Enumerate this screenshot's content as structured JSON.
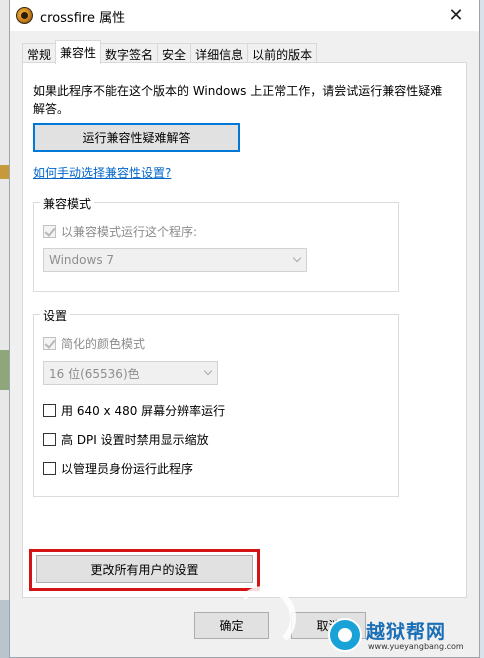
{
  "window": {
    "title": "crossfire 属性",
    "close_label": "✕"
  },
  "tabs": [
    {
      "label": "常规",
      "active": false
    },
    {
      "label": "兼容性",
      "active": true
    },
    {
      "label": "数字签名",
      "active": false
    },
    {
      "label": "安全",
      "active": false
    },
    {
      "label": "详细信息",
      "active": false
    },
    {
      "label": "以前的版本",
      "active": false
    }
  ],
  "compat": {
    "description": "如果此程序不能在这个版本的 Windows 上正常工作，请尝试运行兼容性疑难解答。",
    "troubleshoot_button": "运行兼容性疑难解答",
    "manual_link": "如何手动选择兼容性设置?"
  },
  "compat_mode": {
    "group_title": "兼容模式",
    "checkbox_label": "以兼容模式运行这个程序:",
    "os_select_value": "Windows 7"
  },
  "settings": {
    "group_title": "设置",
    "reduced_color_label": "简化的颜色模式",
    "color_select_value": "16 位(65536)色",
    "res_640_label": "用 640 x 480 屏幕分辨率运行",
    "high_dpi_label": "高 DPI 设置时禁用显示缩放",
    "run_as_admin_label": "以管理员身份运行此程序"
  },
  "all_users_button": "更改所有用户的设置",
  "footer": {
    "ok_label": "确定",
    "cancel_label": "取消"
  },
  "colors": {
    "highlight_border": "#d41414",
    "link": "#0066cc",
    "focus_border": "#0078d7"
  }
}
